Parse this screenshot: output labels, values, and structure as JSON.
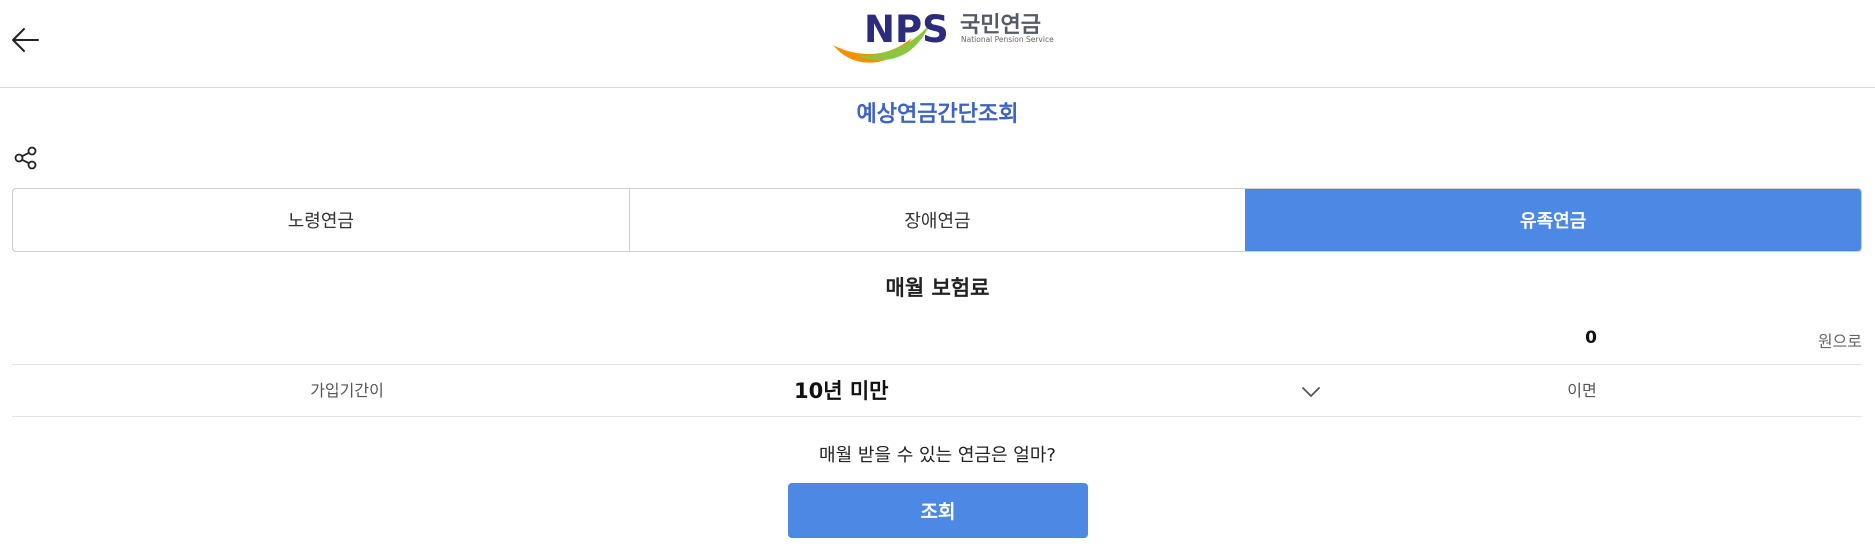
{
  "header": {
    "back_icon": "arrow-left-icon",
    "logo": {
      "brand": "NPS",
      "name_kr": "국민연금",
      "name_en": "National Pension Service",
      "colors": {
        "navy": "#2b2d7c",
        "green": "#8cc63f",
        "orange": "#f39200",
        "text": "#555a66"
      }
    }
  },
  "page_title": "예상연금간단조회",
  "share_icon": "share-icon",
  "tabs": [
    {
      "label": "노령연금",
      "active": false
    },
    {
      "label": "장애연금",
      "active": false
    },
    {
      "label": "유족연금",
      "active": true
    }
  ],
  "form": {
    "premium_title": "매월 보험료",
    "premium_value": "0",
    "premium_unit": "원으로",
    "period_label": "가입기간이",
    "period_selected": "10년 미만",
    "period_suffix": "이면",
    "question": "매월 받을 수 있는 연금은 얼마?",
    "submit_label": "조회"
  },
  "colors": {
    "accent": "#4d88e4",
    "title": "#3f63c5"
  }
}
